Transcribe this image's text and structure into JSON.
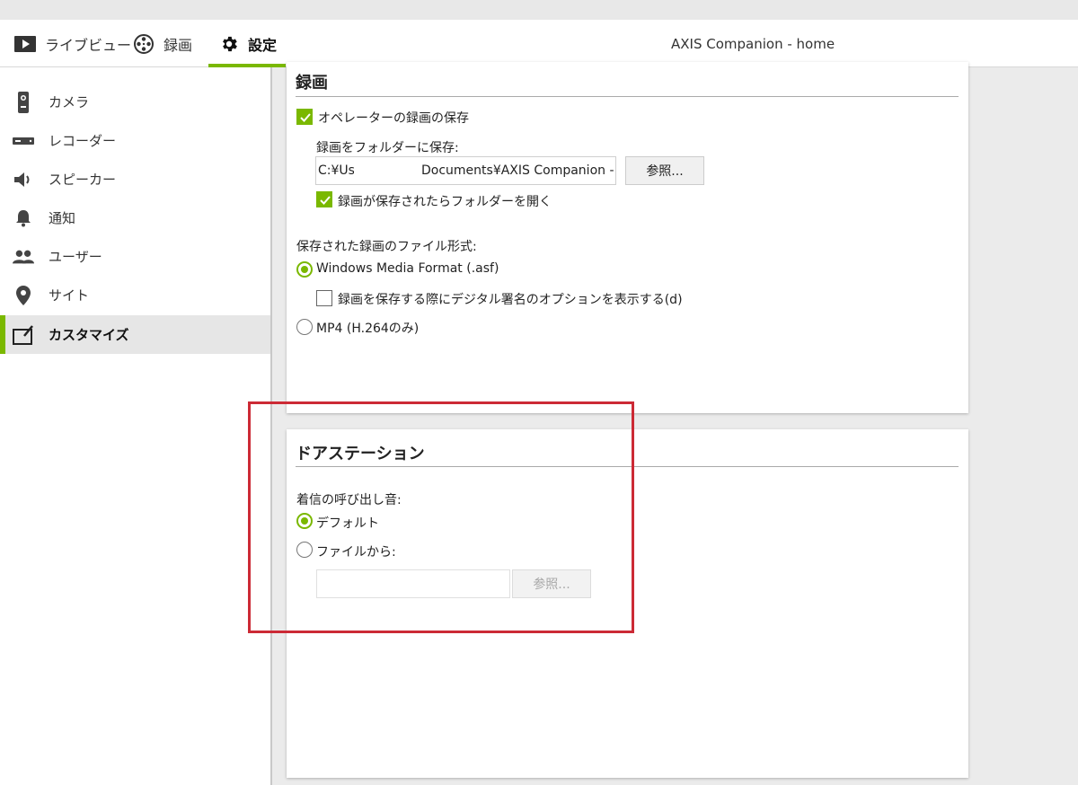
{
  "header": {
    "tabs": [
      {
        "label": "ライブビュー",
        "icon": "play-icon",
        "active": false
      },
      {
        "label": "録画",
        "icon": "film-reel-icon",
        "active": false
      },
      {
        "label": "設定",
        "icon": "gear-icon",
        "active": true
      }
    ],
    "app_title": "AXIS Companion - home"
  },
  "sidebar": {
    "items": [
      {
        "label": "カメラ",
        "icon": "camera-icon"
      },
      {
        "label": "レコーダー",
        "icon": "recorder-icon"
      },
      {
        "label": "スピーカー",
        "icon": "speaker-icon"
      },
      {
        "label": "通知",
        "icon": "bell-icon"
      },
      {
        "label": "ユーザー",
        "icon": "users-icon"
      },
      {
        "label": "サイト",
        "icon": "location-pin-icon"
      },
      {
        "label": "カスタマイズ",
        "icon": "customize-icon",
        "active": true
      }
    ]
  },
  "recording": {
    "title": "録画",
    "save_operator_label": "オペレーターの録画の保存",
    "save_operator_checked": true,
    "folder_label": "録画をフォルダーに保存:",
    "folder_value": "C:¥Us",
    "folder_value_tail": "Documents¥AXIS Companion - ",
    "browse_label": "参照...",
    "open_folder_label": "録画が保存されたらフォルダーを開く",
    "open_folder_checked": true,
    "format_label": "保存された録画のファイル形式:",
    "format_wmf_label": "Windows Media Format (.asf)",
    "format_wmf_selected": true,
    "digital_sig_label": "録画を保存する際にデジタル署名のオプションを表示する(d)",
    "digital_sig_checked": false,
    "format_mp4_label": "MP4 (H.264のみ)",
    "format_mp4_selected": false
  },
  "door_station": {
    "title": "ドアステーション",
    "ringtone_label": "着信の呼び出し音:",
    "default_label": "デフォルト",
    "default_selected": true,
    "from_file_label": "ファイルから:",
    "from_file_selected": false,
    "file_value": "",
    "browse_label": "参照..."
  },
  "colors": {
    "accent": "#7ab800",
    "highlight": "#cc2a35"
  }
}
